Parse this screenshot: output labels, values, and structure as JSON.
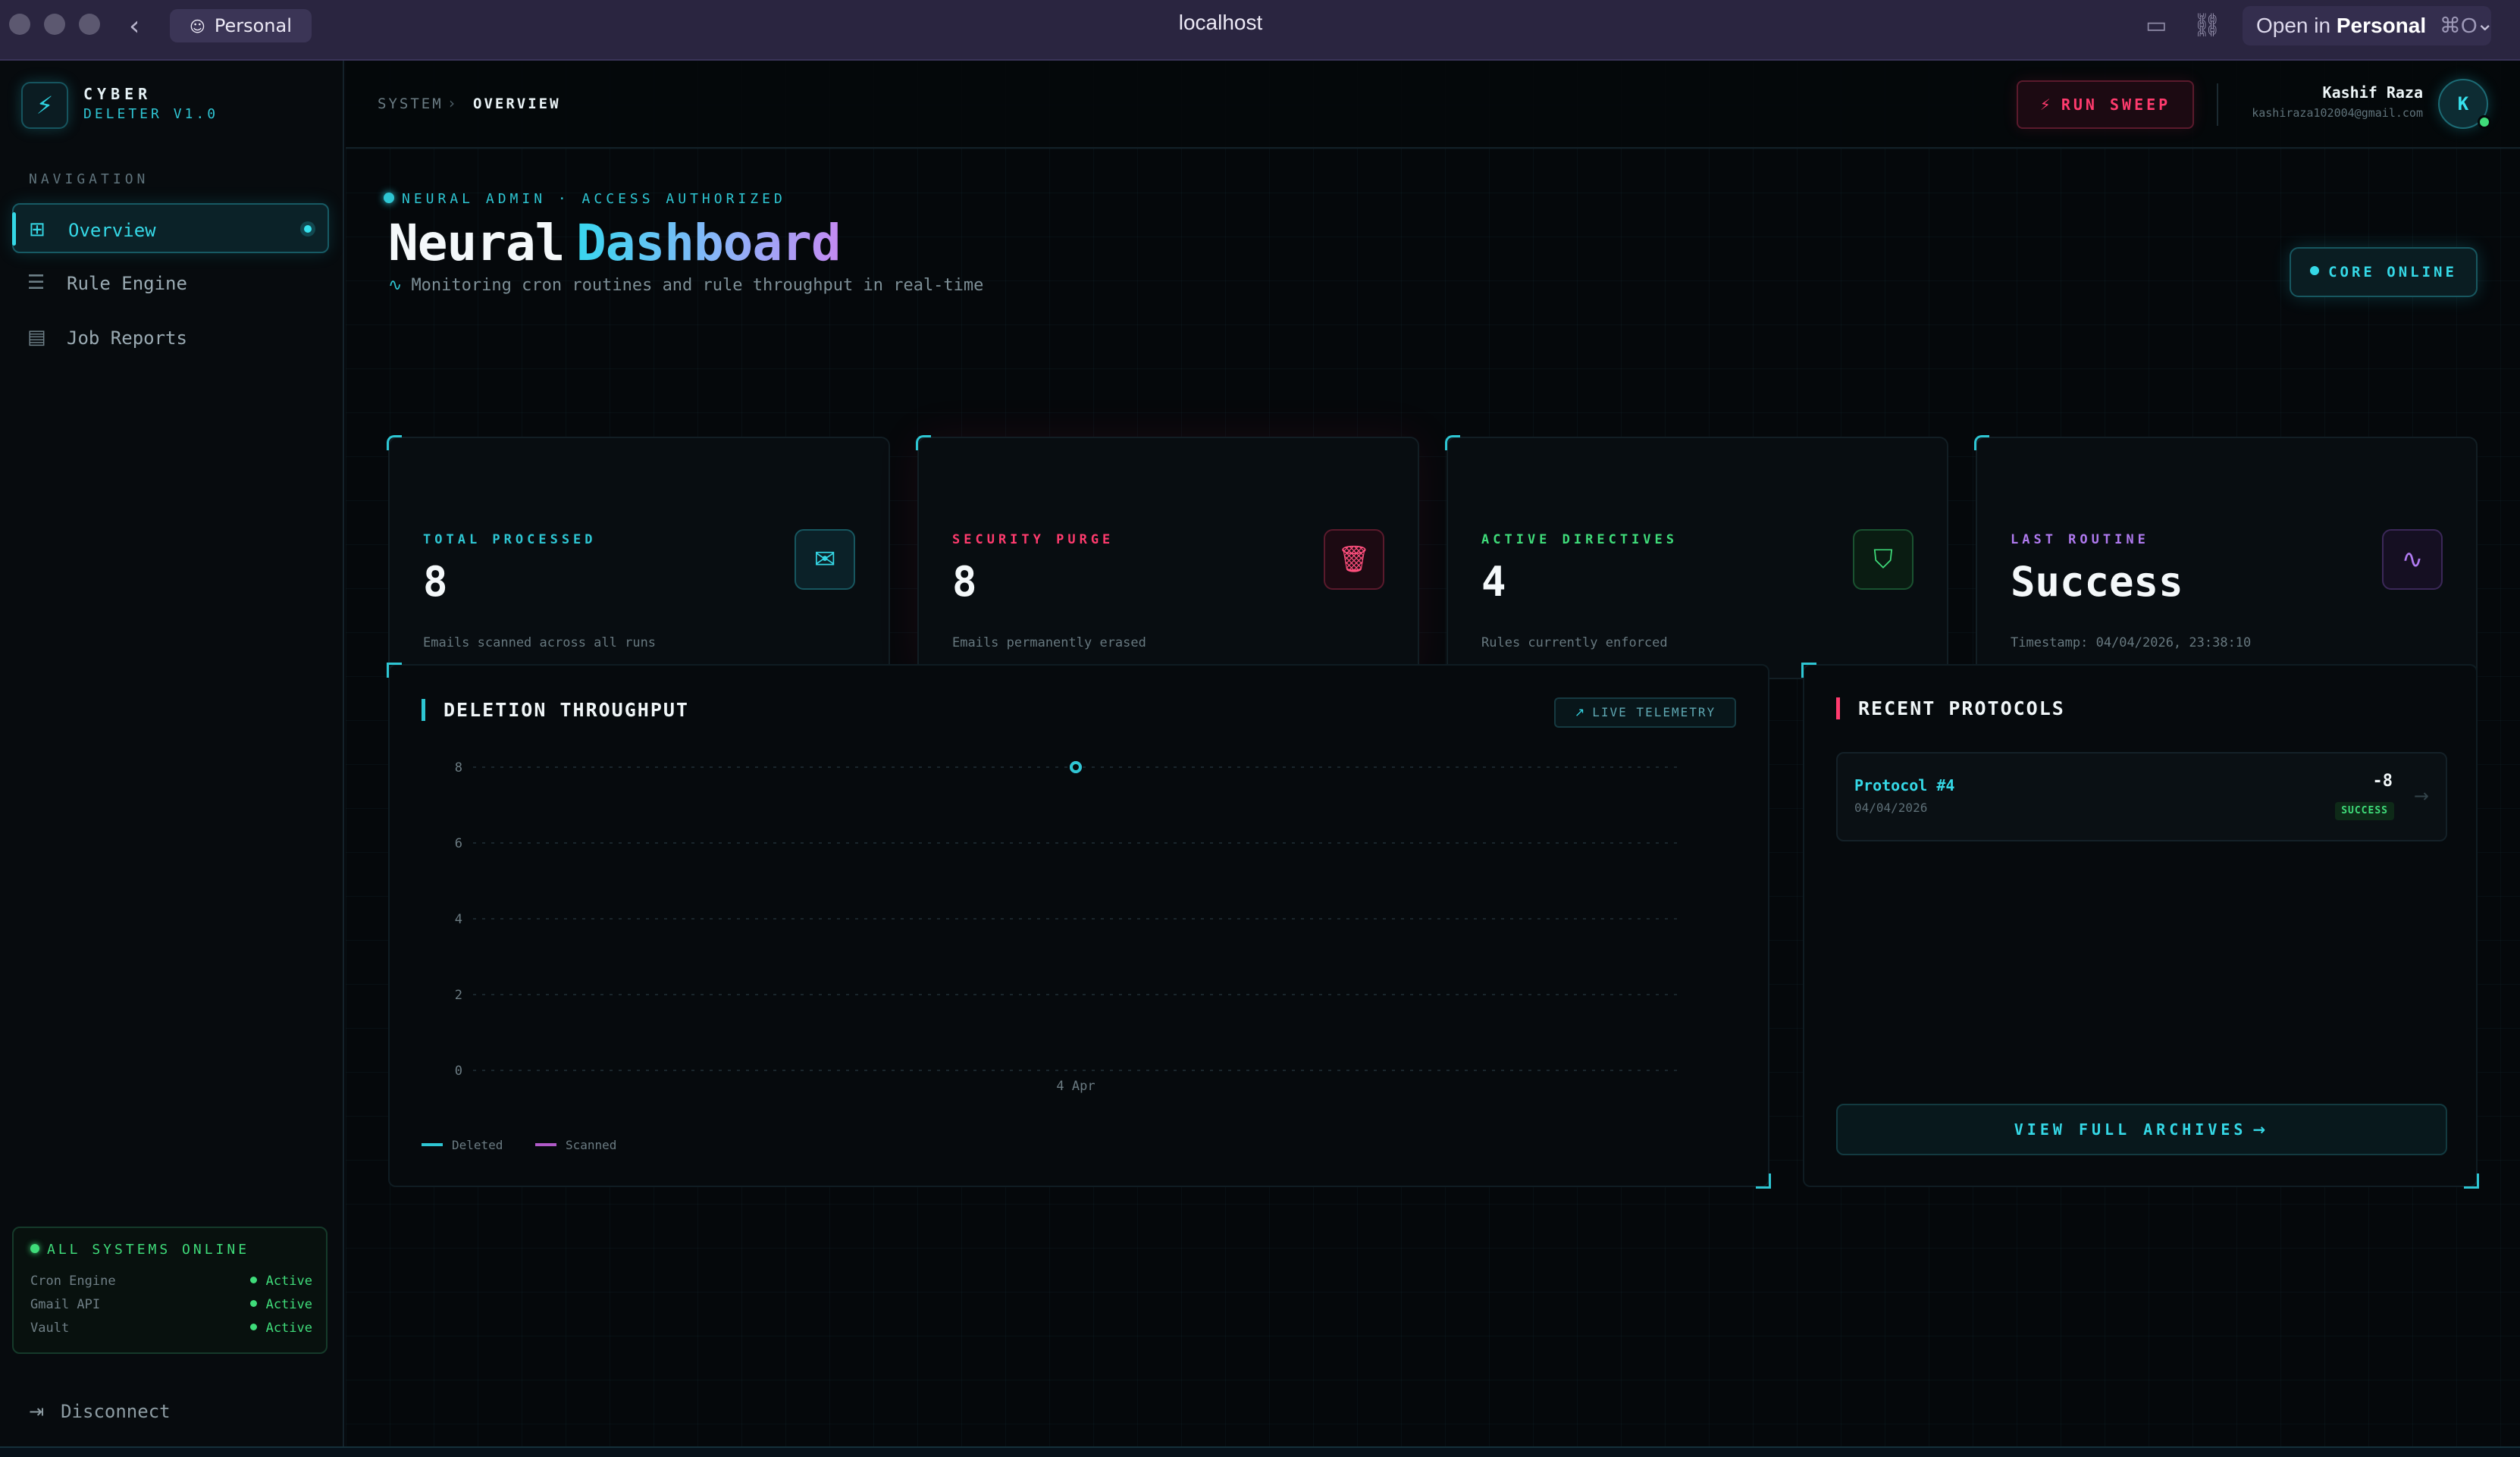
{
  "browser": {
    "profile": "Personal",
    "url": "localhost",
    "open_in_prefix": "Open in",
    "open_in_profile": "Personal",
    "open_in_shortcut": "⌘O"
  },
  "sidebar": {
    "brand_name": "CYBER",
    "brand_version": "DELETER V1.0",
    "nav_heading": "NAVIGATION",
    "items": [
      {
        "label": "Overview",
        "icon": "grid-icon",
        "active": true
      },
      {
        "label": "Rule Engine",
        "icon": "filter-icon",
        "active": false
      },
      {
        "label": "Job Reports",
        "icon": "document-icon",
        "active": false
      }
    ],
    "system_status": {
      "heading": "ALL SYSTEMS ONLINE",
      "rows": [
        {
          "name": "Cron Engine",
          "status": "Active"
        },
        {
          "name": "Gmail API",
          "status": "Active"
        },
        {
          "name": "Vault",
          "status": "Active"
        }
      ]
    },
    "disconnect_label": "Disconnect"
  },
  "header": {
    "breadcrumb": [
      "SYSTEM",
      "OVERVIEW"
    ],
    "run_sweep_label": "RUN SWEEP",
    "user": {
      "name": "Kashif Raza",
      "email": "kashiraza102004@gmail.com",
      "initial": "K"
    }
  },
  "hero": {
    "eyebrow": "NEURAL ADMIN · ACCESS AUTHORIZED",
    "title_plain": "Neural",
    "title_accent": "Dashboard",
    "subtitle": "Monitoring cron routines and rule throughput in real-time",
    "core_status": "CORE ONLINE"
  },
  "stats": [
    {
      "label": "TOTAL PROCESSED",
      "value": "8",
      "desc": "Emails scanned across all runs",
      "icon": "mail-icon",
      "color": "#2ec6d3"
    },
    {
      "label": "SECURITY PURGE",
      "value": "8",
      "desc": "Emails permanently erased",
      "icon": "trash-icon",
      "color": "#ff3b6e"
    },
    {
      "label": "ACTIVE DIRECTIVES",
      "value": "4",
      "desc": "Rules currently enforced",
      "icon": "shield-check-icon",
      "color": "#3fdc7a"
    },
    {
      "label": "LAST ROUTINE",
      "value": "Success",
      "desc": "Timestamp: 04/04/2026, 23:38:10",
      "icon": "pulse-icon",
      "color": "#b07af0"
    }
  ],
  "chart_panel": {
    "title": "DELETION THROUGHPUT",
    "badge": "LIVE TELEMETRY"
  },
  "chart_data": {
    "type": "line",
    "categories": [
      "4 Apr"
    ],
    "series": [
      {
        "name": "Deleted",
        "values": [
          8
        ],
        "color": "#2ec6d3"
      },
      {
        "name": "Scanned",
        "values": [
          8
        ],
        "color": "#b05ac8"
      }
    ],
    "yticks": [
      0,
      2,
      4,
      6,
      8
    ],
    "ylim": [
      0,
      8
    ],
    "grid": true,
    "legend": "bottom-left"
  },
  "protocols": {
    "title": "RECENT PROTOCOLS",
    "items": [
      {
        "name": "Protocol #4",
        "date": "04/04/2026",
        "delta": "-8",
        "status": "SUCCESS"
      }
    ],
    "view_all_label": "VIEW FULL ARCHIVES"
  },
  "colors": {
    "accent": "#2ec6d3",
    "danger": "#ff3b6e",
    "success": "#3fdc7a",
    "violet": "#b07af0",
    "background": "#05080b"
  }
}
